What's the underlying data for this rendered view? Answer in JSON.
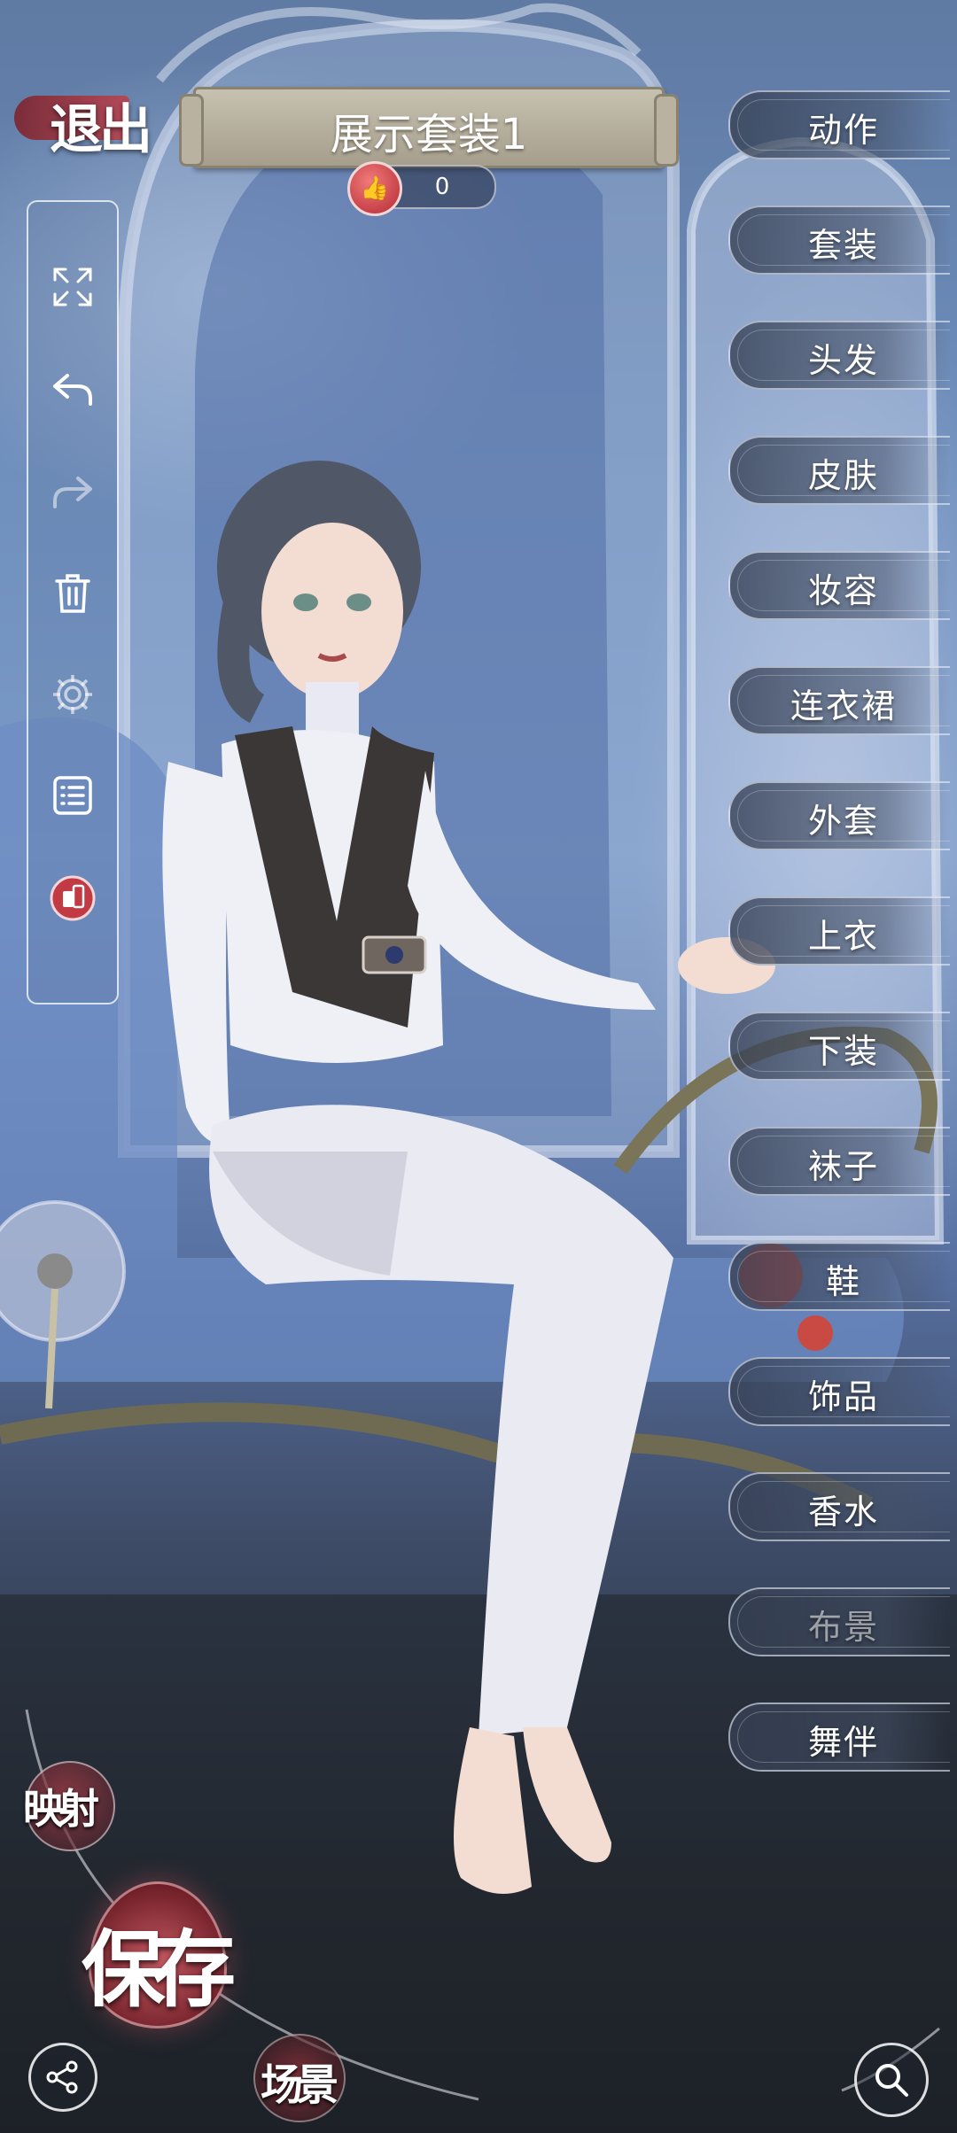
{
  "header": {
    "exit_label": "退出",
    "outfit_title": "展示套装1",
    "like_count": "0"
  },
  "toolbar": {
    "items": [
      {
        "icon": "fullscreen-icon"
      },
      {
        "icon": "undo-icon"
      },
      {
        "icon": "redo-icon"
      },
      {
        "icon": "trash-icon"
      },
      {
        "icon": "gear-icon"
      },
      {
        "icon": "list-icon"
      },
      {
        "icon": "phone-toggle-icon"
      }
    ]
  },
  "menu": {
    "items": [
      {
        "label": "动作"
      },
      {
        "label": "套装"
      },
      {
        "label": "头发"
      },
      {
        "label": "皮肤"
      },
      {
        "label": "妆容"
      },
      {
        "label": "连衣裙"
      },
      {
        "label": "外套"
      },
      {
        "label": "上衣"
      },
      {
        "label": "下装"
      },
      {
        "label": "袜子"
      },
      {
        "label": "鞋"
      },
      {
        "label": "饰品"
      },
      {
        "label": "香水"
      },
      {
        "label": "布景"
      },
      {
        "label": "舞伴"
      }
    ]
  },
  "bottom": {
    "reflect_label": "映射",
    "save_label": "保存",
    "scene_label": "场景"
  },
  "colors": {
    "accent_red": "#b62a33",
    "menu_bg": "#374155",
    "banner": "#b9b2a0"
  }
}
